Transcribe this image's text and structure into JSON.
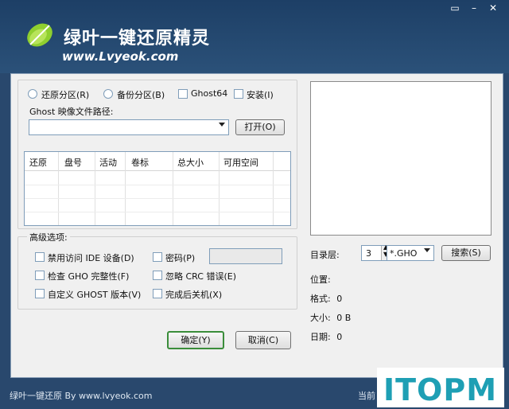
{
  "app": {
    "title": "绿叶一键还原精灵",
    "url": "www.Lvyeok.com"
  },
  "options": {
    "restore_label": "还原分区(R)",
    "backup_label": "备份分区(B)",
    "ghost64_label": "Ghost64",
    "install_label": "安装(I)",
    "path_label": "Ghost 映像文件路径:",
    "path_value": "",
    "open_button": "打开(O)"
  },
  "table": {
    "columns": [
      "还原",
      "盘号",
      "活动",
      "卷标",
      "总大小",
      "可用空间"
    ],
    "rows": []
  },
  "advanced": {
    "title": "高级选项:",
    "disable_ide": "禁用访问 IDE 设备(D)",
    "password": "密码(P)",
    "check_gho": "检查 GHO 完整性(F)",
    "ignore_crc": "忽略 CRC 错误(E)",
    "custom_ghost": "自定义 GHOST 版本(V)",
    "shutdown": "完成后关机(X)"
  },
  "actions": {
    "ok": "确定(Y)",
    "cancel": "取消(C)"
  },
  "search": {
    "dir_level_label": "目录层:",
    "dir_level_value": "3",
    "filter_value": "*.GHO",
    "search_button": "搜索(S)"
  },
  "info": {
    "location_label": "位置:",
    "location_value": "",
    "format_label": "格式:",
    "format_value": "0",
    "size_label": "大小:",
    "size_value": "0 B",
    "date_label": "日期:",
    "date_value": "0"
  },
  "footer": {
    "left_text": "绿叶一键还原 By www.lvyeok.com",
    "right_text": "当前"
  },
  "watermark": {
    "text": "ITOPM"
  },
  "colors": {
    "frame": "#29486d",
    "accent_green": "#3a8d3a",
    "watermark": "#1e9fb4"
  }
}
